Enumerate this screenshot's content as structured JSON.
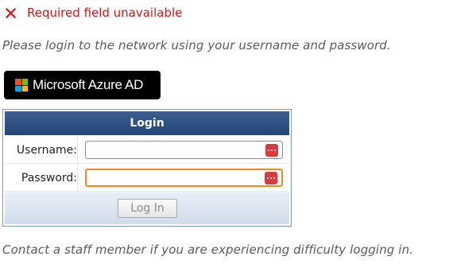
{
  "error": {
    "icon": "close-x-icon",
    "color": "#c41c1c",
    "message": "Required field unavailable"
  },
  "intro_text": "Please login to the network using your username and password.",
  "azure_button": {
    "label": "Microsoft Azure AD",
    "icon": "microsoft-logo-icon",
    "logo_colors": [
      "#f25022",
      "#7fba00",
      "#00a4ef",
      "#ffb900"
    ]
  },
  "login_form": {
    "title": "Login",
    "username": {
      "label": "Username:",
      "value": "",
      "icon": "password-manager-icon"
    },
    "password": {
      "label": "Password:",
      "value": "",
      "icon": "password-manager-icon",
      "focused": true
    },
    "submit_label": "Log In"
  },
  "contact_text": "Contact a staff member if you are experiencing difficulty logging in.",
  "colors": {
    "header": "#2b4c80",
    "focus": "#f08a1c",
    "password_manager": "#d63c3c"
  }
}
